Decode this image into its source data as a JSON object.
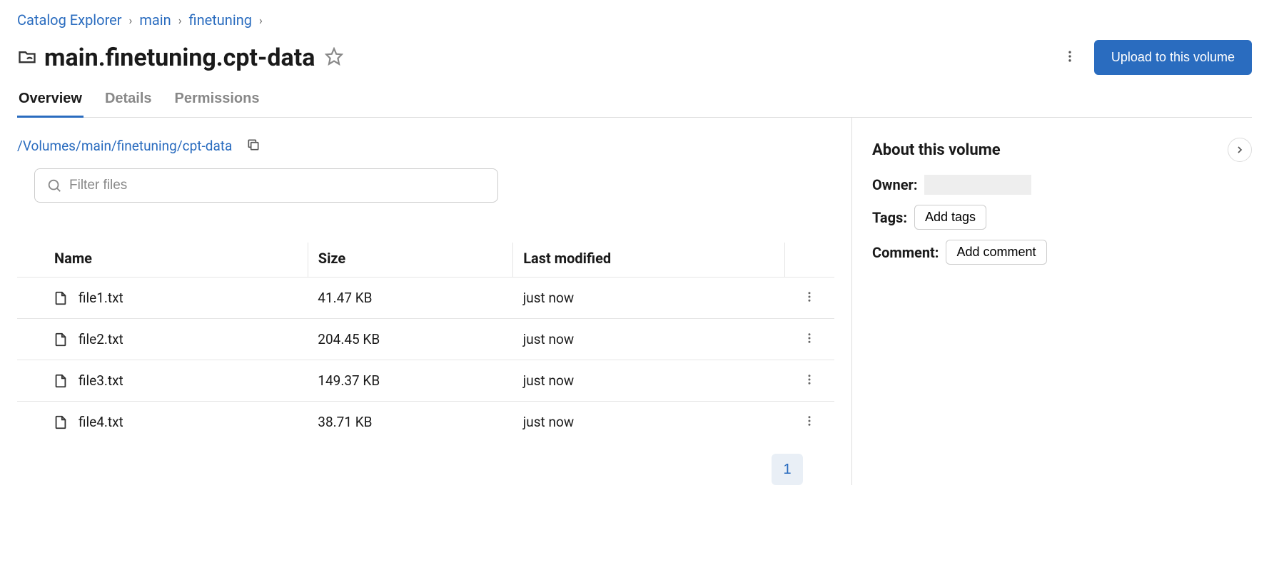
{
  "breadcrumb": {
    "items": [
      {
        "label": "Catalog Explorer"
      },
      {
        "label": "main"
      },
      {
        "label": "finetuning"
      }
    ]
  },
  "header": {
    "title": "main.finetuning.cpt-data",
    "upload_label": "Upload to this volume"
  },
  "tabs": {
    "overview": "Overview",
    "details": "Details",
    "permissions": "Permissions"
  },
  "path": {
    "text": "/Volumes/main/finetuning/cpt-data"
  },
  "filter": {
    "placeholder": "Filter files"
  },
  "table": {
    "columns": {
      "name": "Name",
      "size": "Size",
      "modified": "Last modified"
    },
    "rows": [
      {
        "name": "file1.txt",
        "size": "41.47 KB",
        "modified": "just now"
      },
      {
        "name": "file2.txt",
        "size": "204.45 KB",
        "modified": "just now"
      },
      {
        "name": "file3.txt",
        "size": "149.37 KB",
        "modified": "just now"
      },
      {
        "name": "file4.txt",
        "size": "38.71 KB",
        "modified": "just now"
      }
    ]
  },
  "pagination": {
    "current": "1"
  },
  "about": {
    "title": "About this volume",
    "owner_label": "Owner:",
    "tags_label": "Tags:",
    "tags_btn": "Add tags",
    "comment_label": "Comment:",
    "comment_btn": "Add comment"
  }
}
